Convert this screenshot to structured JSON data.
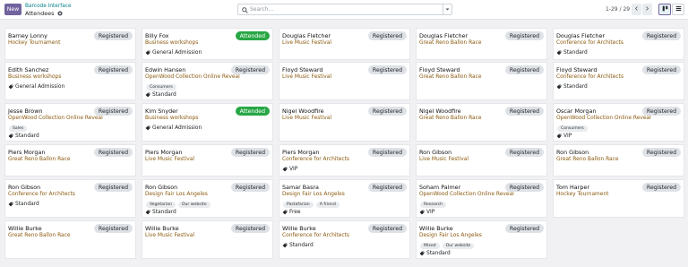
{
  "header": {
    "new_label": "New",
    "breadcrumb_parent": "Barcode Interface",
    "breadcrumb_current": "Attendees",
    "search_placeholder": "Search...",
    "pager_text": "1-29 / 29"
  },
  "icons": {
    "gear": "gear-icon",
    "search": "search-icon",
    "toggle": "chevron-down-icon",
    "prev": "chevron-left-icon",
    "next": "chevron-right-icon",
    "kanban": "kanban-view-icon",
    "list": "list-view-icon",
    "ticket": "ticket-icon"
  },
  "colors": {
    "brand": "#71639e",
    "link": "#017e84",
    "event_text": "#8b5a0f",
    "attended": "#28a745",
    "registered_bg": "#dee2e6"
  },
  "cards": [
    {
      "name": "Barney Lonny",
      "event": "Hockey Tournament",
      "status": "Registered",
      "tags": [],
      "ticket": ""
    },
    {
      "name": "Billy Fox",
      "event": "Business workshops",
      "status": "Attended",
      "tags": [],
      "ticket": "General Admission"
    },
    {
      "name": "Douglas Fletcher",
      "event": "Live Music Festival",
      "status": "Registered",
      "tags": [],
      "ticket": ""
    },
    {
      "name": "Douglas Fletcher",
      "event": "Great Reno Ballon Race",
      "status": "Registered",
      "tags": [],
      "ticket": ""
    },
    {
      "name": "Douglas Fletcher",
      "event": "Conference for Architects",
      "status": "Registered",
      "tags": [],
      "ticket": "Standard"
    },
    {
      "name": "Edith Sanchez",
      "event": "Business workshops",
      "status": "Registered",
      "tags": [],
      "ticket": "General Admission"
    },
    {
      "name": "Edwin Hansen",
      "event": "OpenWood Collection Online Reveal",
      "status": "Registered",
      "tags": [
        "Consumers"
      ],
      "ticket": "Standard"
    },
    {
      "name": "Floyd Steward",
      "event": "Live Music Festival",
      "status": "Registered",
      "tags": [],
      "ticket": ""
    },
    {
      "name": "Floyd Steward",
      "event": "Great Reno Ballon Race",
      "status": "Registered",
      "tags": [],
      "ticket": ""
    },
    {
      "name": "Floyd Steward",
      "event": "Conference for Architects",
      "status": "Registered",
      "tags": [],
      "ticket": "Standard"
    },
    {
      "name": "Jesse Brown",
      "event": "OpenWood Collection Online Reveal",
      "status": "Registered",
      "tags": [
        "Sales"
      ],
      "ticket": "Standard"
    },
    {
      "name": "Kim Snyder",
      "event": "Business workshops",
      "status": "Attended",
      "tags": [],
      "ticket": "General Admission"
    },
    {
      "name": "Nigel Woodfire",
      "event": "Live Music Festival",
      "status": "Registered",
      "tags": [],
      "ticket": ""
    },
    {
      "name": "Nigel Woodfire",
      "event": "Great Reno Ballon Race",
      "status": "Registered",
      "tags": [],
      "ticket": ""
    },
    {
      "name": "Oscar Morgan",
      "event": "OpenWood Collection Online Reveal",
      "status": "Registered",
      "tags": [
        "Consumers"
      ],
      "ticket": "VIP"
    },
    {
      "name": "Piers Morgan",
      "event": "Great Reno Ballon Race",
      "status": "Registered",
      "tags": [],
      "ticket": ""
    },
    {
      "name": "Piers Morgan",
      "event": "Live Music Festival",
      "status": "Registered",
      "tags": [],
      "ticket": ""
    },
    {
      "name": "Piers Morgan",
      "event": "Conference for Architects",
      "status": "Registered",
      "tags": [],
      "ticket": "VIP"
    },
    {
      "name": "Ron Gibson",
      "event": "Live Music Festival",
      "status": "Registered",
      "tags": [],
      "ticket": ""
    },
    {
      "name": "Ron Gibson",
      "event": "Great Reno Ballon Race",
      "status": "Registered",
      "tags": [],
      "ticket": ""
    },
    {
      "name": "Ron Gibson",
      "event": "Conference for Architects",
      "status": "Registered",
      "tags": [],
      "ticket": "Standard"
    },
    {
      "name": "Ron Gibson",
      "event": "Design Fair Los Angeles",
      "status": "Registered",
      "tags": [
        "Vegetarian",
        "Our website"
      ],
      "ticket": "Standard"
    },
    {
      "name": "Samar Basra",
      "event": "Design Fair Los Angeles",
      "status": "Registered",
      "tags": [
        "Pastafarian",
        "A friend"
      ],
      "ticket": "Free"
    },
    {
      "name": "Soham Palmer",
      "event": "OpenWood Collection Online Reveal",
      "status": "Registered",
      "tags": [
        "Research"
      ],
      "ticket": "VIP"
    },
    {
      "name": "Tom Harper",
      "event": "Hockey Tournament",
      "status": "Registered",
      "tags": [],
      "ticket": ""
    },
    {
      "name": "Willie Burke",
      "event": "Great Reno Ballon Race",
      "status": "Registered",
      "tags": [],
      "ticket": ""
    },
    {
      "name": "Willie Burke",
      "event": "Live Music Festival",
      "status": "Registered",
      "tags": [],
      "ticket": ""
    },
    {
      "name": "Willie Burke",
      "event": "Conference for Architects",
      "status": "Registered",
      "tags": [],
      "ticket": "Standard"
    },
    {
      "name": "Willie Burke",
      "event": "Design Fair Los Angeles",
      "status": "Registered",
      "tags": [
        "Mixed",
        "Our website"
      ],
      "ticket": "Standard"
    }
  ]
}
